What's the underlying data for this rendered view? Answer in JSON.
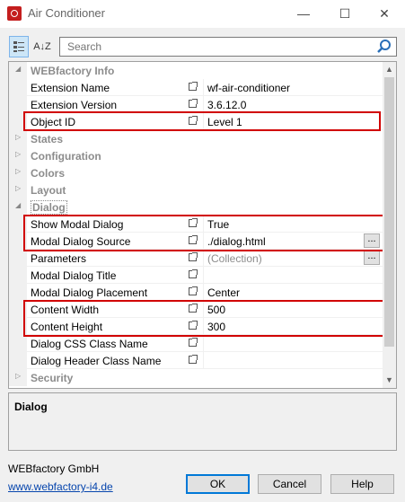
{
  "window": {
    "title": "Air Conditioner",
    "minimize": "—",
    "maximize": "☐",
    "close": "✕"
  },
  "toolbar": {
    "categorized_icon": "categorized-icon",
    "alphabetical_label": "A↓Z",
    "search_placeholder": "Search"
  },
  "grid": {
    "categories": {
      "webfactory_info": "WEBfactory Info",
      "states": "States",
      "configuration": "Configuration",
      "colors": "Colors",
      "layout": "Layout",
      "dialog": "Dialog",
      "security": "Security"
    },
    "rows": [
      {
        "name": "Extension Name",
        "value": "wf-air-conditioner"
      },
      {
        "name": "Extension Version",
        "value": "3.6.12.0"
      },
      {
        "name": "Object ID",
        "value": "Level 1"
      },
      {
        "name": "Show Modal Dialog",
        "value": "True"
      },
      {
        "name": "Modal Dialog Source",
        "value": "./dialog.html"
      },
      {
        "name": "Parameters",
        "value": "(Collection)"
      },
      {
        "name": "Modal Dialog Title",
        "value": ""
      },
      {
        "name": "Modal Dialog Placement",
        "value": "Center"
      },
      {
        "name": "Content Width",
        "value": "500"
      },
      {
        "name": "Content Height",
        "value": "300"
      },
      {
        "name": "Dialog CSS Class Name",
        "value": ""
      },
      {
        "name": "Dialog Header Class Name",
        "value": ""
      }
    ],
    "ellipsis": "..."
  },
  "description": {
    "title": "Dialog"
  },
  "footer": {
    "company": "WEBfactory GmbH",
    "link": "www.webfactory-i4.de",
    "ok": "OK",
    "cancel": "Cancel",
    "help": "Help"
  },
  "colors": {
    "highlight": "#d10000",
    "accent": "#0078d7",
    "link": "#0645ad"
  }
}
